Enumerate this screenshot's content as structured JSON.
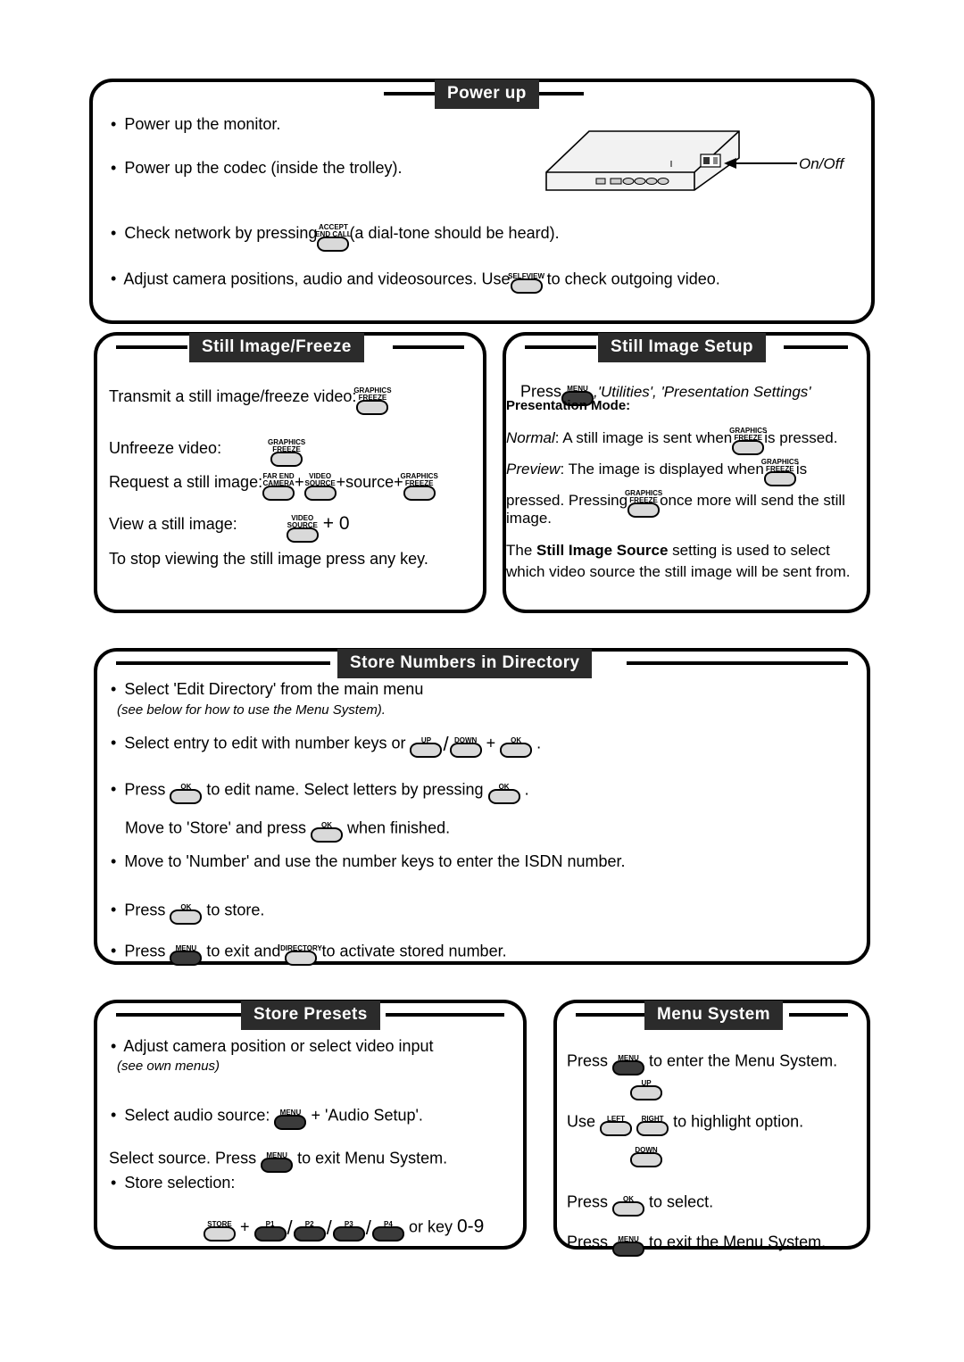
{
  "panels": {
    "power_up": {
      "title": "Power up",
      "lines": [
        "Power up the monitor.",
        "Power up the codec (inside the trolley).",
        "Check network by pressing",
        "(a dial-tone should be heard).",
        "Adjust camera positions, audio and videosources. Use",
        "to check outgoing video."
      ],
      "keys": {
        "end_call": "END CALL",
        "accept": "ACCEPT",
        "selfview": "SELFVIEW"
      },
      "onoff_label": "On/Off"
    },
    "still_image_freeze": {
      "title": "Still Image/Freeze",
      "l1": "Transmit a still image/freeze video:",
      "l2": "Unfreeze video:",
      "l3": "Request a still image:",
      "l3b": "+source+",
      "l4": "View a still image:",
      "l4b": "+ 0",
      "l5": "To stop viewing the still image press any key.",
      "keys": {
        "graphics": "GRAPHICS",
        "freeze": "FREEZE",
        "far_end": "FAR END",
        "camera": "CAMERA",
        "video": "VIDEO",
        "source": "SOURCE",
        "plus": "+"
      }
    },
    "still_image_setup": {
      "title": "Still Image Setup",
      "press": "Press",
      "path": ",'Utilities', 'Presentation Settings'",
      "mode_heading": "Presentation Mode:",
      "normal_a": "Normal",
      "normal_b": ": A still image is sent when",
      "normal_c": "is pressed.",
      "preview_a": "Preview",
      "preview_b": ": The image is displayed when",
      "preview_c": "is",
      "preview_d": "pressed. Pressing",
      "preview_e": "once more  will send the still",
      "preview_f": "image.",
      "note_a": "The",
      "note_b": "Still Image Source",
      "note_c": "setting is used to select",
      "note_d": "which video source the still image will be sent from.",
      "keys": {
        "menu": "MENU",
        "graphics": "GRAPHICS",
        "freeze": "FREEZE"
      }
    },
    "store_numbers": {
      "title": "Store Numbers in Directory",
      "l1": "Select 'Edit Directory' from the main menu",
      "l1_note": "(see below for how to use the Menu System).",
      "l2": "Select entry to edit with number keys or",
      "l2b": "+",
      "l2c": ".",
      "l3a": "Press",
      "l3b": "to edit name. Select letters by pressing",
      "l3c": ".",
      "l4a": "Move to 'Store' and press",
      "l4b": "when finished.",
      "l5": "Move to 'Number' and use the number keys to enter the ISDN number.",
      "l6a": "Press",
      "l6b": "to store.",
      "l7a": "Press",
      "l7b": "to exit and",
      "l7c": "to activate stored number.",
      "keys": {
        "up": "UP",
        "down": "DOWN",
        "ok": "OK",
        "menu": "MENU",
        "directory": "DIRECTORY"
      }
    },
    "store_presets": {
      "title": "Store Presets",
      "l1": "Adjust camera position or select video input",
      "l1_note": "(see own menus)",
      "l2a": "Select audio source:",
      "l2b": "+ 'Audio Setup'.",
      "l3a": "Select source. Press",
      "l3b": "to exit Menu System.",
      "l4": "Store selection:",
      "l5b": "+",
      "l5c": "or key",
      "l5d": "0-9",
      "keys": {
        "menu": "MENU",
        "store": "STORE",
        "p1": "P1",
        "p2": "P2",
        "p3": "P3",
        "p4": "P4"
      }
    },
    "menu_system": {
      "title": "Menu System",
      "l1a": "Press",
      "l1b": "to enter the Menu System.",
      "l2a": "Use",
      "l2b": "to highlight option.",
      "l3a": "Press",
      "l3b": "to select.",
      "l4a": "Press",
      "l4b": "to exit the Menu System.",
      "keys": {
        "menu": "MENU",
        "up": "UP",
        "left": "LEFT",
        "right": "RIGHT",
        "down": "DOWN",
        "ok": "OK"
      }
    }
  }
}
